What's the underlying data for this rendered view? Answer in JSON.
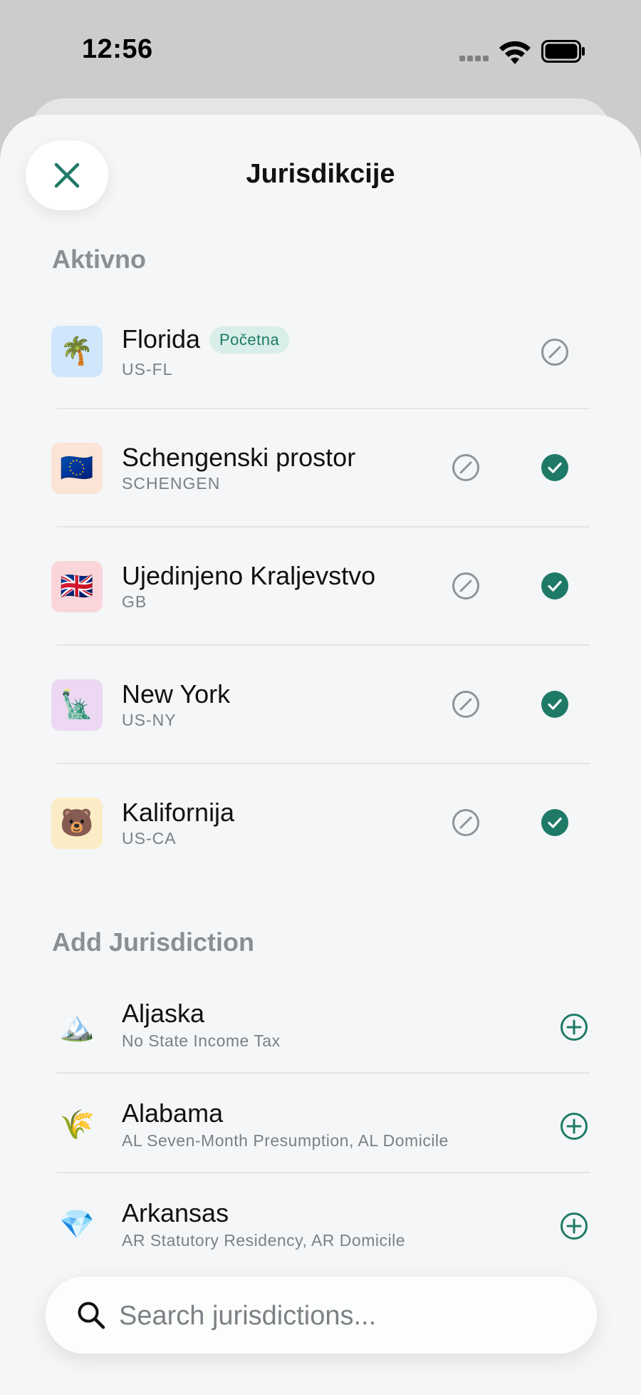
{
  "status_bar": {
    "time": "12:56"
  },
  "sheet": {
    "title": "Jurisdikcije"
  },
  "active_section": {
    "title": "Aktivno",
    "items": [
      {
        "name": "Florida",
        "code": "US-FL",
        "icon": "🌴",
        "tile_color": "#cfe6fb",
        "badge": "Početna",
        "checked": null
      },
      {
        "name": "Schengenski prostor",
        "code": "SCHENGEN",
        "icon": "🇪🇺",
        "tile_color": "#fbe3d6",
        "checked": true
      },
      {
        "name": "Ujedinjeno Kraljevstvo",
        "code": "GB",
        "icon": "🇬🇧",
        "tile_color": "#fad6da",
        "checked": true
      },
      {
        "name": "New York",
        "code": "US-NY",
        "icon": "🗽",
        "tile_color": "#ecd8f2",
        "checked": true
      },
      {
        "name": "Kalifornija",
        "code": "US-CA",
        "icon": "🐻",
        "tile_color": "#fbecc6",
        "checked": true
      }
    ]
  },
  "add_section": {
    "title": "Add Jurisdiction",
    "items": [
      {
        "name": "Aljaska",
        "subtitle": "No State Income Tax",
        "icon": "🏔️"
      },
      {
        "name": "Alabama",
        "subtitle": "AL Seven-Month Presumption, AL Domicile",
        "icon": "🌾"
      },
      {
        "name": "Arkansas",
        "subtitle": "AR Statutory Residency, AR Domicile",
        "icon": "💎"
      }
    ]
  },
  "search": {
    "placeholder": "Search jurisdictions..."
  },
  "colors": {
    "accent": "#1e7a67",
    "check_fill": "#1e7a67",
    "muted_icon": "#8f9497"
  }
}
